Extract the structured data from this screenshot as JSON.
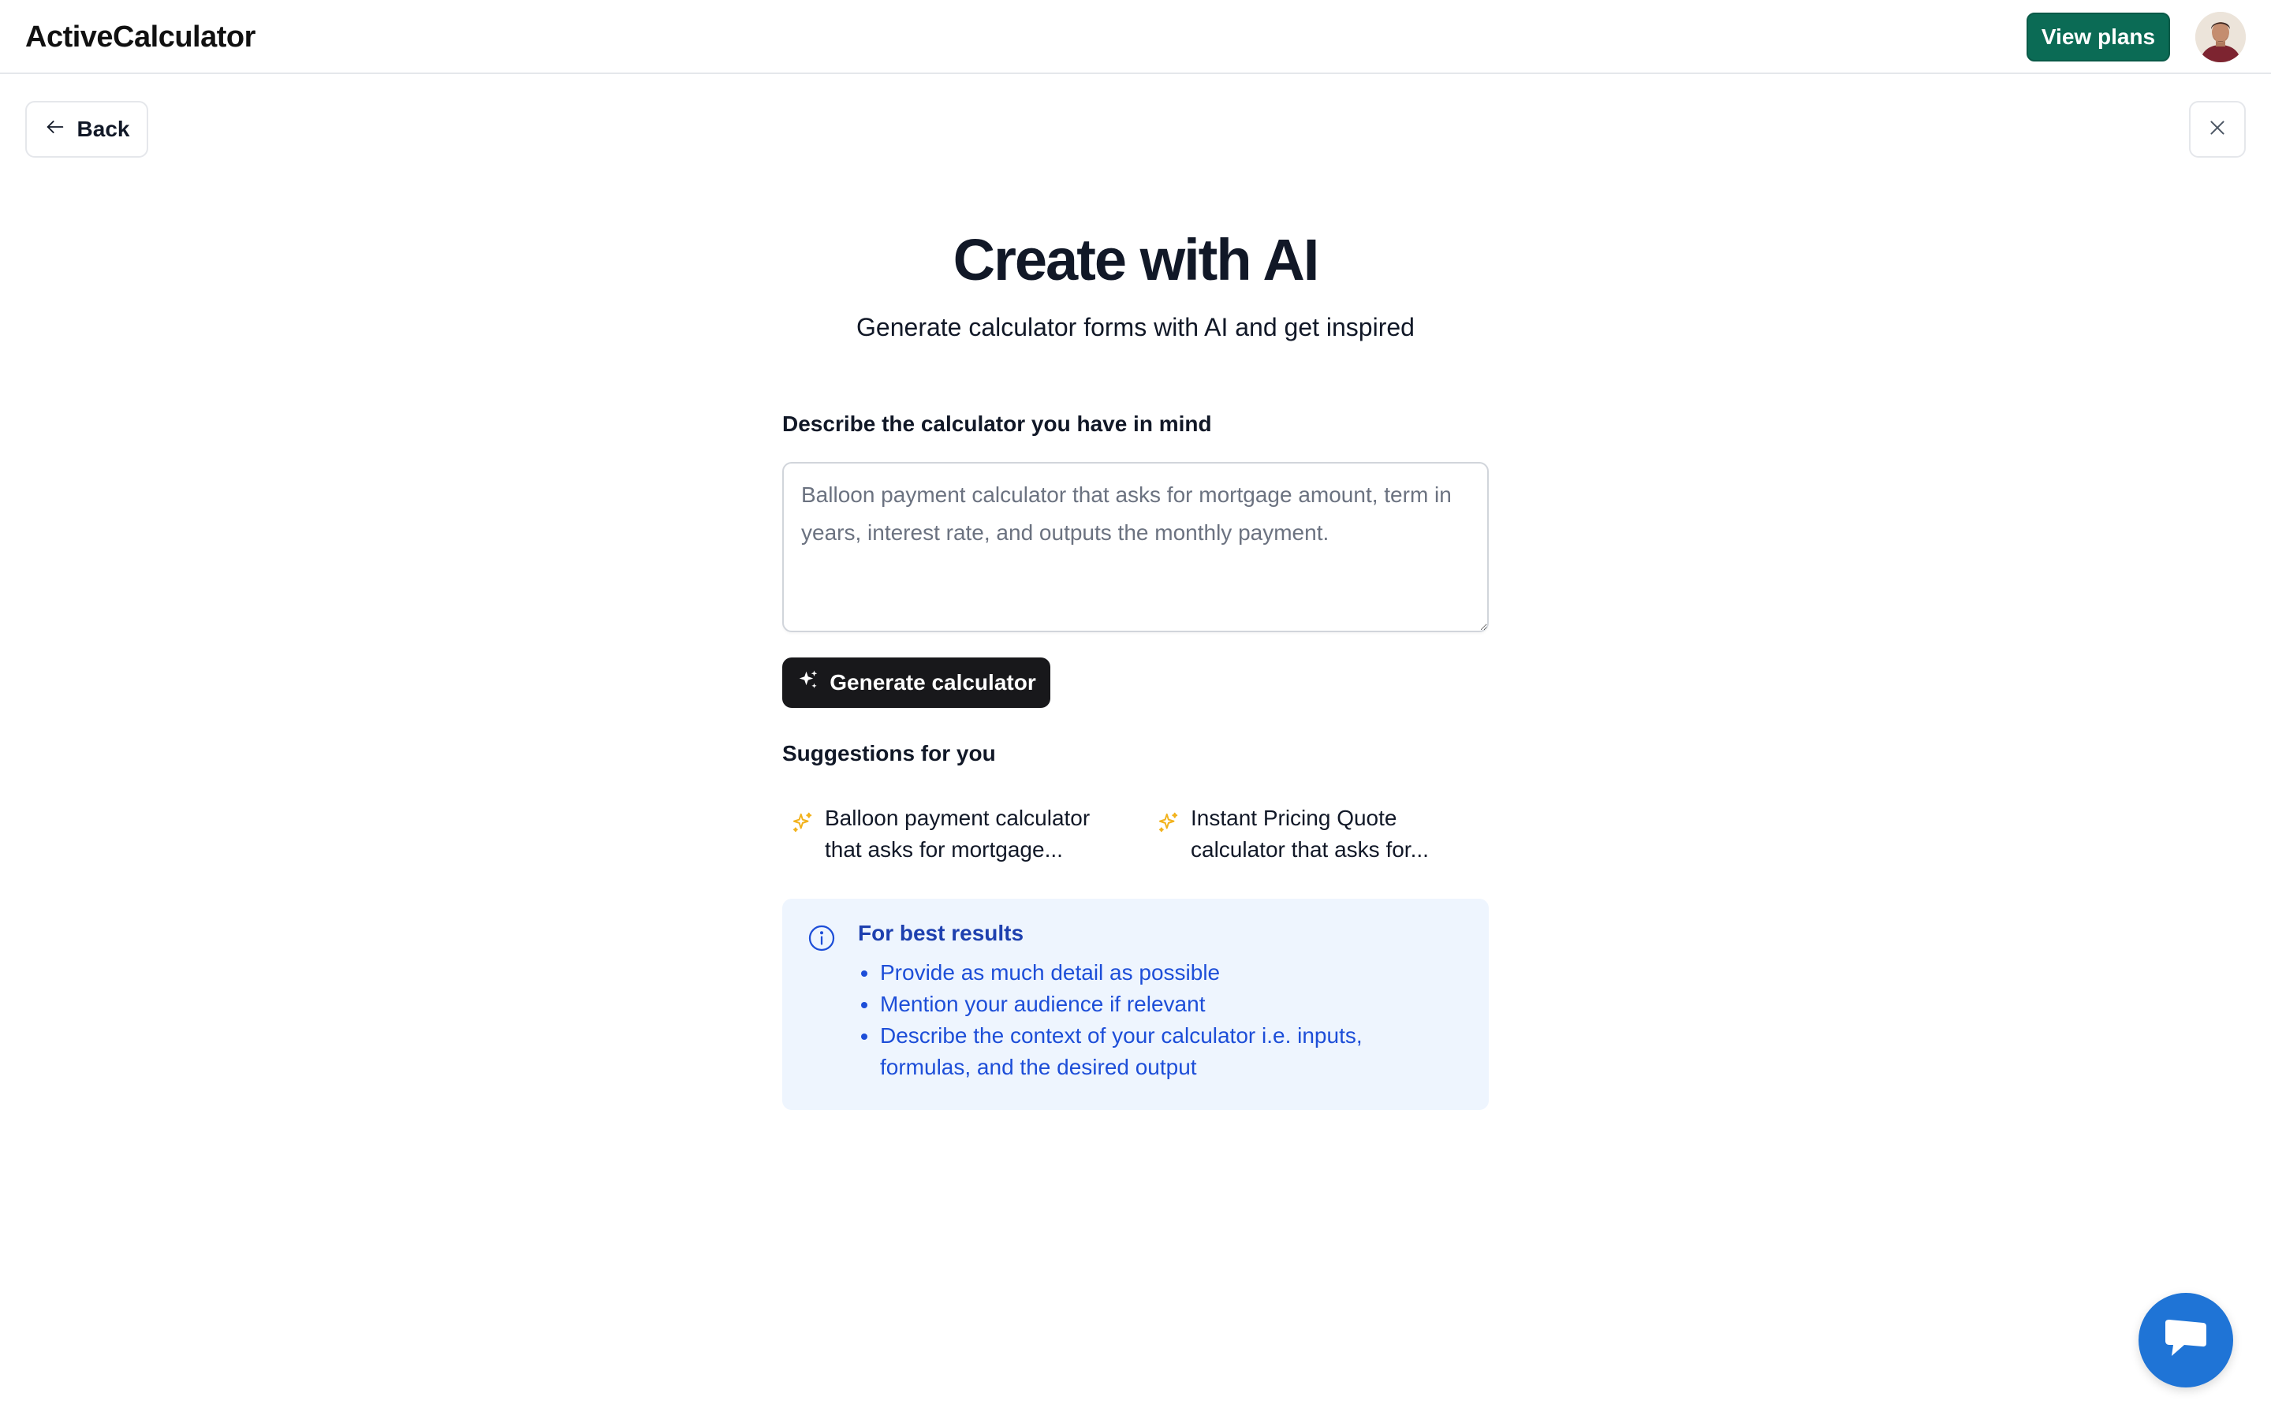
{
  "header": {
    "logo": "ActiveCalculator",
    "view_plans_label": "View plans"
  },
  "nav": {
    "back_label": "Back"
  },
  "main": {
    "title": "Create with AI",
    "subtitle": "Generate calculator forms with AI and get inspired",
    "prompt_label": "Describe the calculator you have in mind",
    "prompt_value": "",
    "prompt_placeholder": "Balloon payment calculator that asks for mortgage amount, term in years, interest rate, and outputs the monthly payment.",
    "generate_label": "Generate calculator"
  },
  "suggestions": {
    "heading": "Suggestions for you",
    "items": [
      {
        "text": "Balloon payment calculator that asks for mortgage..."
      },
      {
        "text": "Instant Pricing Quote calculator that asks for..."
      }
    ]
  },
  "tips": {
    "title": "For best results",
    "items": [
      "Provide as much detail as possible",
      "Mention your audience if relevant",
      "Describe the context of your calculator i.e. inputs, formulas, and the desired output"
    ]
  },
  "colors": {
    "brand_green": "#0b6b55",
    "primary_dark": "#18181b",
    "tips_bg": "#eef5fe",
    "tips_text": "#1d4ed8",
    "sparkle": "#f2b21c",
    "chat_blue": "#1f74d6"
  },
  "icons": {
    "back": "arrow-left-icon",
    "close": "close-icon",
    "generate": "sparkles-icon",
    "suggestion": "sparkle-outline-icon",
    "info": "info-circle-icon",
    "chat": "chat-bubble-icon"
  }
}
